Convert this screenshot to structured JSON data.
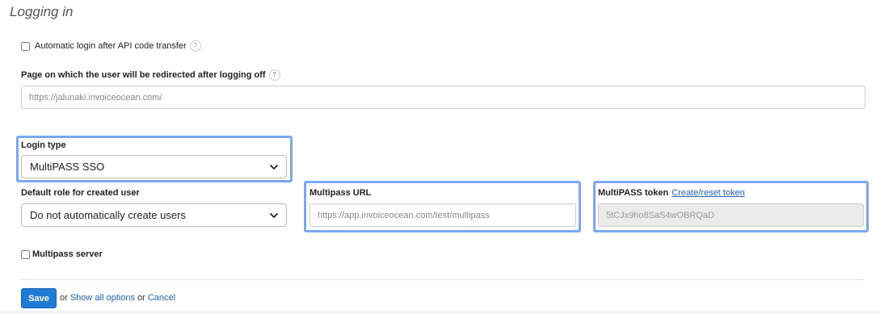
{
  "section": {
    "title": "Logging in"
  },
  "auto_login": {
    "label": "Automatic login after API code transfer",
    "checked": false,
    "help": "?"
  },
  "logoff_redirect": {
    "label": "Page on which the user will be redirected after logging off",
    "help": "?",
    "placeholder": "https://jalunaki.invoiceocean.com/"
  },
  "login_type": {
    "label": "Login type",
    "selected": "MultiPASS SSO"
  },
  "default_role": {
    "label": "Default role for created user",
    "selected": "Do not automatically create users"
  },
  "multipass_url": {
    "label": "Multipass URL",
    "placeholder": "https://app.invoiceocean.com/test/multipass"
  },
  "multipass_token": {
    "label": "MultiPASS token",
    "link": "Create/reset token",
    "value": "5tCJx9ho8SaS4wOBRQaD"
  },
  "multipass_server": {
    "label": "Multipass server",
    "checked": false
  },
  "footer": {
    "save": "Save",
    "or1": "or",
    "show_all": "Show all options",
    "or2": "or",
    "cancel": "Cancel"
  },
  "colors": {
    "highlight": "#7aa7ef",
    "primary": "#1f7bd6",
    "link": "#1f5fb4"
  },
  "icons": {
    "help": "help-circle-icon",
    "dropdown": "chevron-down-icon"
  }
}
